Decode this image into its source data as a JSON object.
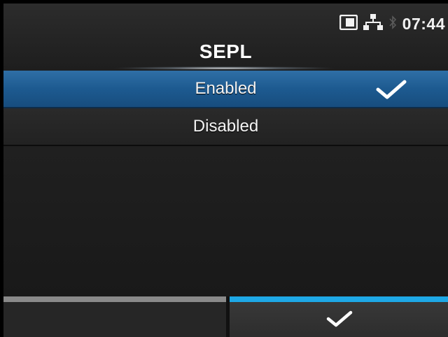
{
  "status_bar": {
    "icons": [
      "sd-card-icon",
      "network-icon",
      "bluetooth-icon"
    ],
    "time": "07:44"
  },
  "title": "SEPL",
  "options": [
    {
      "label": "Enabled",
      "selected": true
    },
    {
      "label": "Disabled",
      "selected": false
    }
  ],
  "softkeys": {
    "left": {
      "icon": ""
    },
    "right": {
      "icon": "check-icon"
    }
  },
  "colors": {
    "selection": "#1d5a90",
    "active_softkey_bar": "#1ea8e6",
    "inactive_softkey_bar": "#8a8a8a"
  }
}
